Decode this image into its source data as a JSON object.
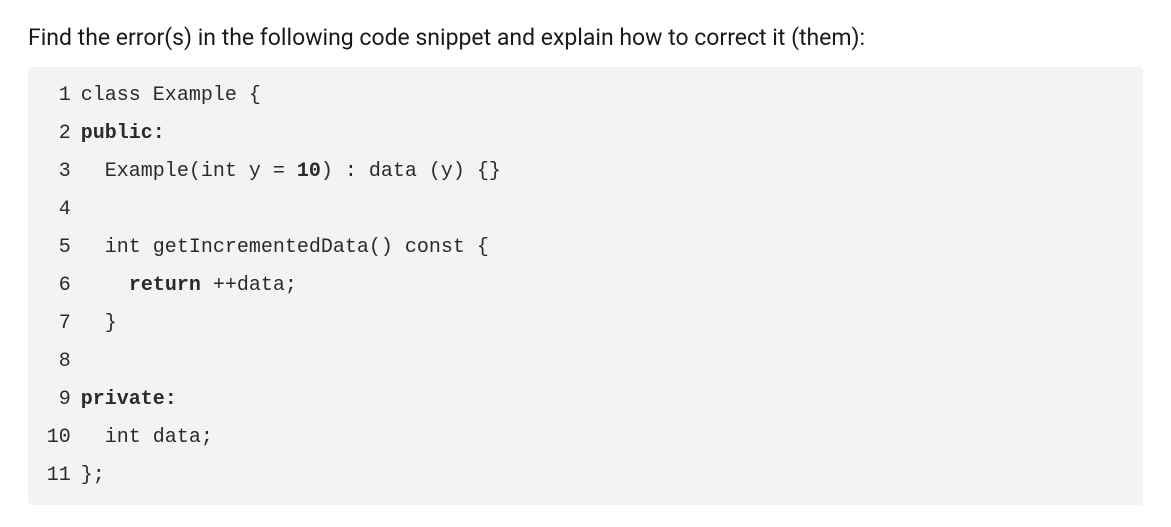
{
  "prompt": "Find the error(s) in the following code snippet and explain how to correct it (them):",
  "code": {
    "lines": [
      {
        "n": "1",
        "tokens": [
          {
            "t": "class Example {",
            "cls": ""
          }
        ]
      },
      {
        "n": "2",
        "tokens": [
          {
            "t": "public:",
            "cls": "kw"
          }
        ]
      },
      {
        "n": "3",
        "tokens": [
          {
            "t": "  Example(int y = ",
            "cls": ""
          },
          {
            "t": "10",
            "cls": "lit"
          },
          {
            "t": ") : data (y) {}",
            "cls": ""
          }
        ]
      },
      {
        "n": "4",
        "tokens": [
          {
            "t": "",
            "cls": ""
          }
        ]
      },
      {
        "n": "5",
        "tokens": [
          {
            "t": "  int getIncrementedData() const {",
            "cls": ""
          }
        ]
      },
      {
        "n": "6",
        "tokens": [
          {
            "t": "    ",
            "cls": ""
          },
          {
            "t": "return",
            "cls": "kw"
          },
          {
            "t": " ++data;",
            "cls": ""
          }
        ]
      },
      {
        "n": "7",
        "tokens": [
          {
            "t": "  }",
            "cls": ""
          }
        ]
      },
      {
        "n": "8",
        "tokens": [
          {
            "t": "",
            "cls": ""
          }
        ]
      },
      {
        "n": "9",
        "tokens": [
          {
            "t": "private:",
            "cls": "kw"
          }
        ]
      },
      {
        "n": "10",
        "tokens": [
          {
            "t": "  int data;",
            "cls": ""
          }
        ]
      },
      {
        "n": "11",
        "tokens": [
          {
            "t": "};",
            "cls": ""
          }
        ]
      }
    ]
  }
}
